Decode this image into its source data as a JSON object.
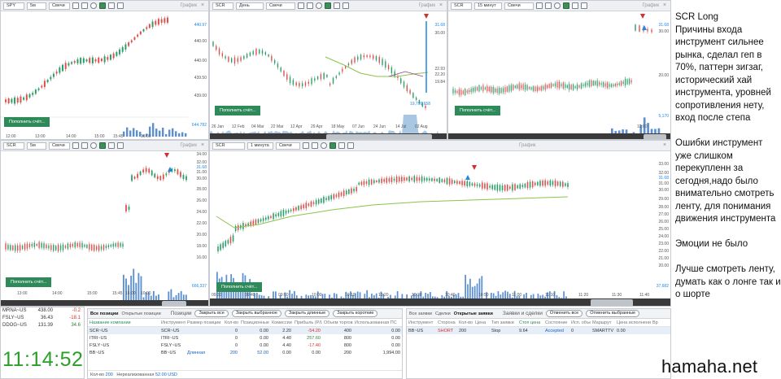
{
  "charts": {
    "c1": {
      "symbol": "SPY",
      "tf": "5м",
      "type": "Свечи",
      "title": "График",
      "price_labels": [
        "440.97",
        "440.00",
        "440.00",
        "439.50",
        "439.00"
      ],
      "vol_label": "644.782",
      "time_labels": [
        "12:00",
        "13:00",
        "14:00",
        "15:00",
        "15:45",
        "16:00"
      ],
      "add": "Пополнить счёт..."
    },
    "c2": {
      "symbol": "SCR",
      "tf": "День",
      "type": "Свечи",
      "title": "График",
      "price_labels": [
        "31.68",
        "30.00",
        "22.93",
        "22.20",
        "19.84"
      ],
      "vol_label": "19,799,658",
      "time_labels": [
        "26 Jan",
        "12 Feb",
        "04 Mar",
        "22 Mar",
        "12 Apr",
        "29 Apr",
        "18 May",
        "07 Jun",
        "24 Jun",
        "14 Jul",
        "02 Aug"
      ],
      "add": "Пополнить счёт..."
    },
    "c3": {
      "symbol": "SCR",
      "tf": "15 минут",
      "type": "Свечи",
      "title": "График",
      "price_labels": [
        "31.68",
        "30.00",
        "20.00"
      ],
      "vol_label": "5,170",
      "time_labels": [
        "12:00"
      ],
      "add": "Пополнить счёт..."
    },
    "c4": {
      "symbol": "SCR",
      "tf": "5м",
      "type": "Свечи",
      "title": "График",
      "price_labels": [
        "34.00",
        "32.00",
        "31.68",
        "31.00",
        "30.00",
        "28.00",
        "26.00",
        "24.00",
        "22.00",
        "20.00",
        "18.00",
        "16.00"
      ],
      "vol_label": "666,337",
      "time_labels": [
        "13:00",
        "14:00",
        "15:00",
        "15:45",
        "16:00",
        "10:00"
      ],
      "add": "Пополнить счёт..."
    },
    "c5": {
      "symbol": "SCR",
      "tf": "1 минута",
      "type": "Свечи",
      "title": "График",
      "price_labels": [
        "33.00",
        "32.00",
        "31.68",
        "31.00",
        "30.00",
        "29.00",
        "28.00",
        "27.00",
        "26.00",
        "25.00",
        "24.00",
        "23.00",
        "22.00",
        "21.00",
        "20.00"
      ],
      "vol_label": "37,682",
      "time_labels": [
        "09:30",
        "09:40",
        "09:50",
        "10:00",
        "10:10",
        "10:20",
        "10:30",
        "10:40",
        "10:50",
        "11:00",
        "11:10",
        "11:20",
        "11:30",
        "11:40"
      ],
      "add": "Пополнить счёт..."
    }
  },
  "notes": {
    "title": "SCR Long",
    "reasons": "Причины входа инструмент сильнее рынка, сделал геп в 70%, паттерн зигзаг, исторический хай инструмента, уровней сопротивления нету, вход после степа",
    "errors": "Ошибки инструмент уже слишком перекупленн за сегодня,надо было внимательно смотреть ленту,  для понимания движения инструмента",
    "emotions": "Эмоции не было",
    "better": "Лучше смотреть ленту, думать как о лонге так и о шорте"
  },
  "watermark": "hamaha.net",
  "clock": {
    "time": "11:14:52",
    "rows": [
      {
        "name": "MRNA~US",
        "value": "438.00",
        "change": "-0.2"
      },
      {
        "name": "FSLY~US",
        "value": "36.43",
        "change": "-18.1"
      },
      {
        "name": "DDOG~US",
        "value": "131.39",
        "change": "34.6"
      }
    ]
  },
  "positions": {
    "tabs": [
      "Все позиции",
      "Открытые позиции",
      "Позиции"
    ],
    "buttons": [
      "Закрыть все",
      "Закрыть выбранное",
      "Закрыть длинные",
      "Закрыть короткие"
    ],
    "columns": [
      "Название компании",
      "Инструмент",
      "Размер позиции",
      "Кол-во",
      "Позиционные",
      "Комиссии",
      "Прибыль (P/L)",
      "Объем торгов",
      "Использованная ПС"
    ],
    "rows": [
      [
        "SCR~US",
        "SCR~US",
        "",
        "0",
        "0.00",
        "2.20",
        "-54.20",
        "400",
        "0.00"
      ],
      [
        "ITRI~US",
        "ITRI~US",
        "",
        "0",
        "0.00",
        "4.40",
        "257.60",
        "800",
        "0.00"
      ],
      [
        "FSLY~US",
        "FSLY~US",
        "",
        "0",
        "0.00",
        "4.40",
        "-17.40",
        "800",
        "0.00"
      ],
      [
        "BB~US",
        "BB~US",
        "Длинная",
        "200",
        "52.00",
        "0.00",
        "0.00",
        "200",
        "1,994.00"
      ]
    ],
    "footer_qty_label": "Кол-во",
    "footer_qty": "200",
    "footer_unreal_label": "Нереализованная",
    "footer_unreal": "52.00 USD"
  },
  "orders": {
    "tabs": [
      "Все заявки",
      "Сделки",
      "Открытые заявки"
    ],
    "section_title": "Заявки и сделки",
    "buttons": [
      "Отменить все",
      "Отменить выбранные"
    ],
    "columns": [
      "Инструмент",
      "Сторона",
      "Кол-во",
      "Цена",
      "Тип заявки",
      "Стоп цена",
      "Состояние",
      "Исп. объем",
      "Маршрут",
      "Цена исполнения",
      "Вр"
    ],
    "rows": [
      [
        "BB~US",
        "SHORT",
        "200",
        "",
        "Stop",
        "9.64",
        "Accepted",
        "0",
        "SMARTTV",
        "0.00",
        ""
      ]
    ]
  }
}
